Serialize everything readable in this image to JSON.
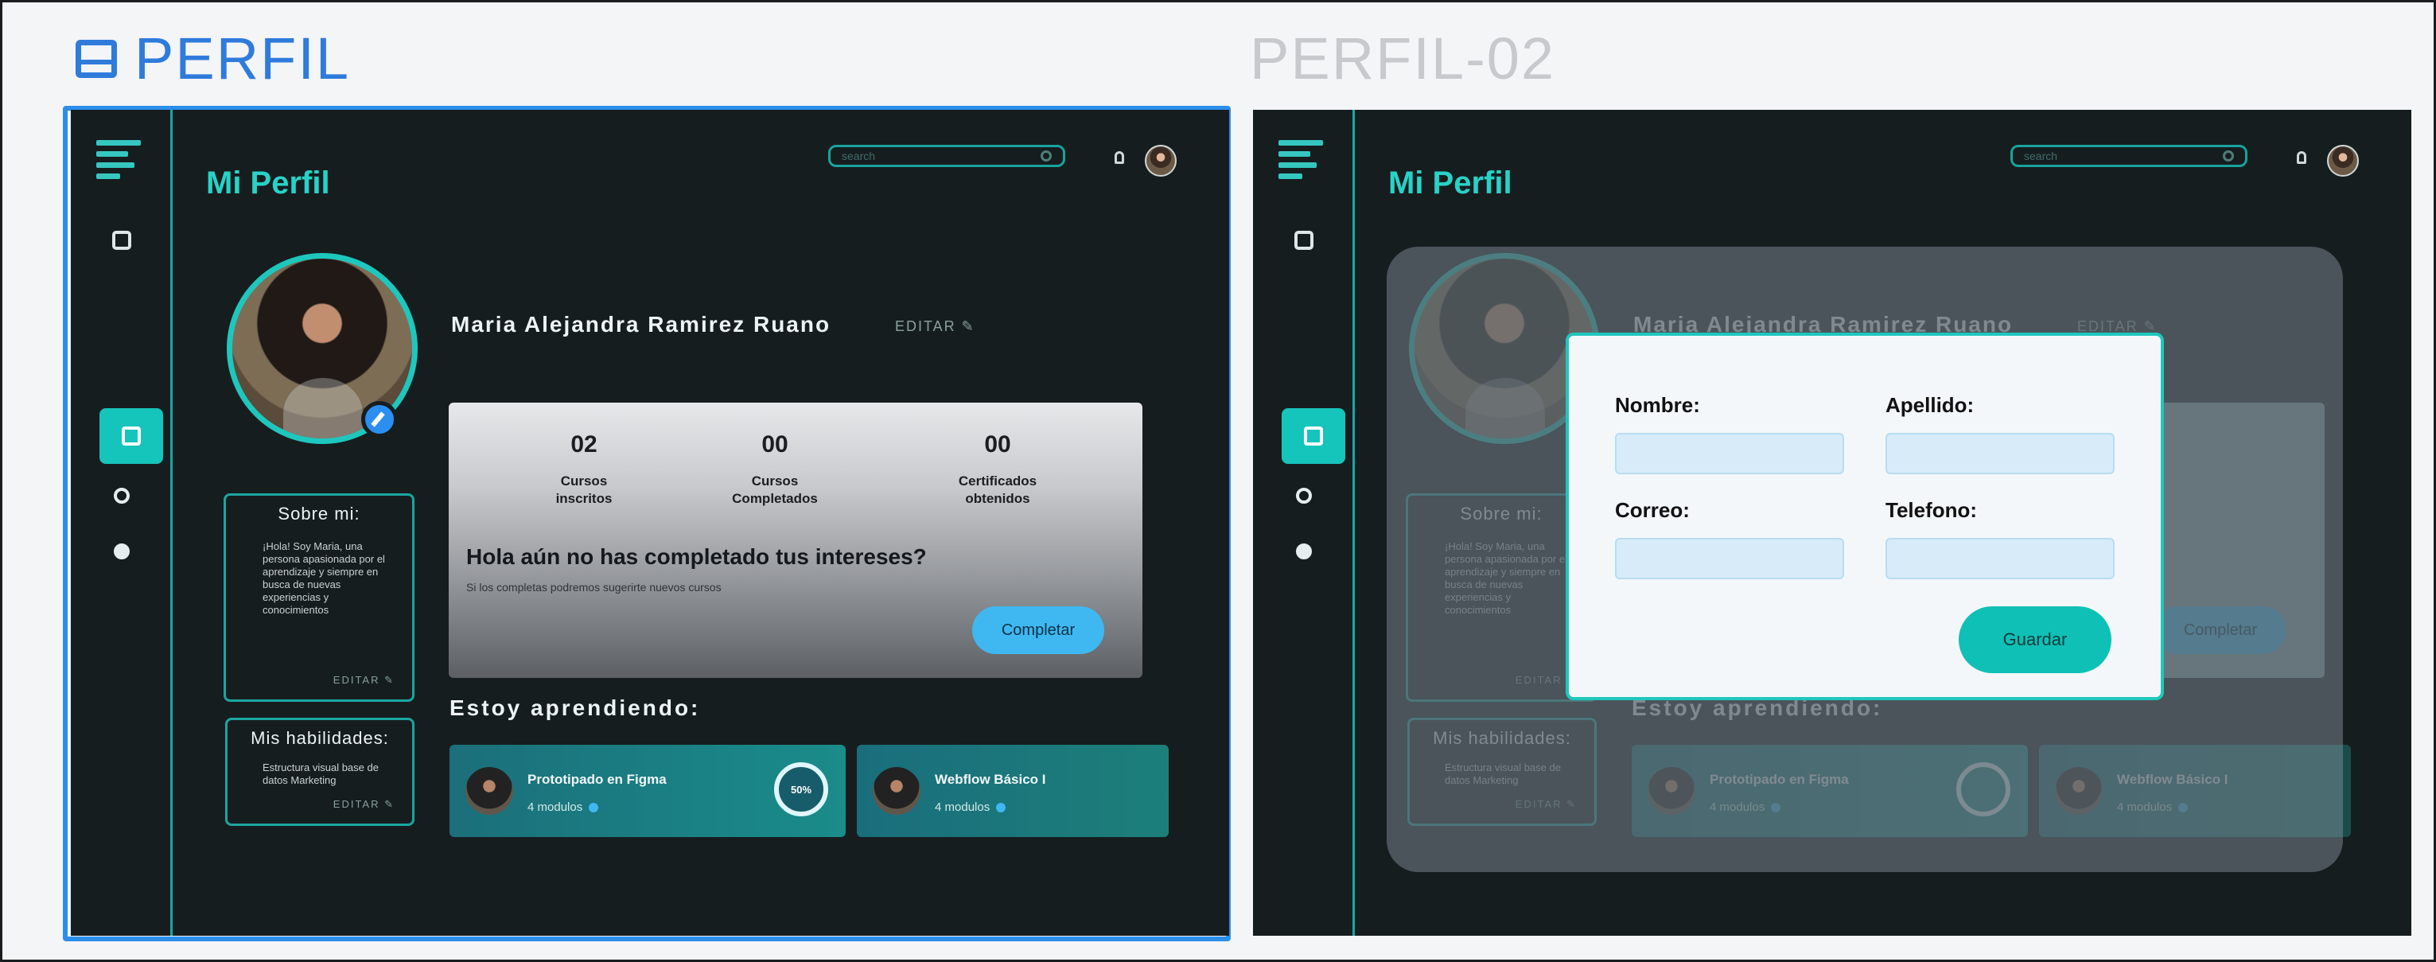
{
  "frames": [
    {
      "label": "PERFIL"
    },
    {
      "label": "PERFIL-02"
    }
  ],
  "header": {
    "title": "Mi Perfil",
    "search_placeholder": "search"
  },
  "profile": {
    "name": "Maria Alejandra Ramirez Ruano",
    "edit_label": "EDITAR ✎"
  },
  "stats": [
    {
      "value": "02",
      "label": "Cursos\ninscritos"
    },
    {
      "value": "00",
      "label": "Cursos\nCompletados"
    },
    {
      "value": "00",
      "label": "Certificados\nobtenidos"
    }
  ],
  "interests": {
    "heading": "Hola aún no has completado tus intereses?",
    "subtext": "Si los completas podremos sugerirte nuevos cursos",
    "button": "Completar"
  },
  "about": {
    "title": "Sobre mi:",
    "text": "¡Hola! Soy Maria, una persona apasionada por el aprendizaje y siempre en busca de nuevas experiencias y conocimientos",
    "edit": "EDITAR ✎"
  },
  "skills": {
    "title": "Mis habilidades:",
    "text": "Estructura visual base de datos Marketing",
    "edit": "EDITAR ✎"
  },
  "learning": {
    "title": "Estoy aprendiendo:",
    "courses": [
      {
        "name": "Prototipado en Figma",
        "modules": "4 modulos",
        "progress": "50%"
      },
      {
        "name": "Webflow Básico I",
        "modules": "4 modulos"
      }
    ]
  },
  "modal": {
    "nombre": "Nombre:",
    "apellido": "Apellido:",
    "correo": "Correo:",
    "telefono": "Telefono:",
    "save": "Guardar"
  },
  "colors": {
    "accent": "#1ec7bd",
    "selection": "#2b8eea",
    "background": "#161d1f",
    "button_blue": "#3fb8f1"
  }
}
